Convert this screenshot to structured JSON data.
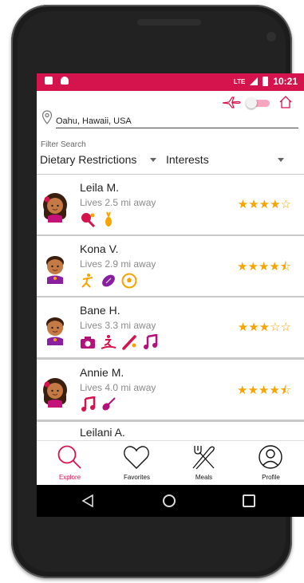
{
  "status_bar": {
    "lte": "LTE",
    "time": "10:21"
  },
  "header": {
    "location": "Oahu, Hawaii, USA",
    "filter_label": "Filter Search",
    "dropdown_dietary": "Dietary Restrictions",
    "dropdown_interests": "Interests",
    "accent": "#d5144e"
  },
  "hosts": [
    {
      "name": "Leila M.",
      "distance": "Lives 2.5 mi away",
      "stars": "★★★★☆",
      "rating": 4,
      "icons": [
        "tennis-icon",
        "pineapple-icon"
      ]
    },
    {
      "name": "Kona V.",
      "distance": "Lives 2.9 mi away",
      "stars": "★★★★⯪",
      "rating": 4.5,
      "icons": [
        "dance-icon",
        "football-icon",
        "soccer-ball-icon"
      ]
    },
    {
      "name": "Bane H.",
      "distance": "Lives 3.3 mi away",
      "stars": "★★★☆☆",
      "rating": 3,
      "icons": [
        "camera-icon",
        "surfing-icon",
        "baseball-bat-icon",
        "music-note-icon"
      ]
    },
    {
      "name": "Annie M.",
      "distance": "Lives 4.0 mi away",
      "stars": "★★★★⯪",
      "rating": 4.5,
      "icons": [
        "music-note-icon",
        "guitar-icon"
      ]
    },
    {
      "name": "Leilani A.",
      "distance": "",
      "stars": "",
      "icons": []
    }
  ],
  "tabs": [
    {
      "label": "Explore",
      "icon": "search-icon",
      "active": true
    },
    {
      "label": "Favorites",
      "icon": "heart-icon",
      "active": false
    },
    {
      "label": "Meals",
      "icon": "fork-knife-icon",
      "active": false
    },
    {
      "label": "Profile",
      "icon": "user-icon",
      "active": false
    }
  ],
  "colors": {
    "accent": "#d5144e",
    "icon_color": "#b5117a",
    "star": "#f7a400"
  }
}
